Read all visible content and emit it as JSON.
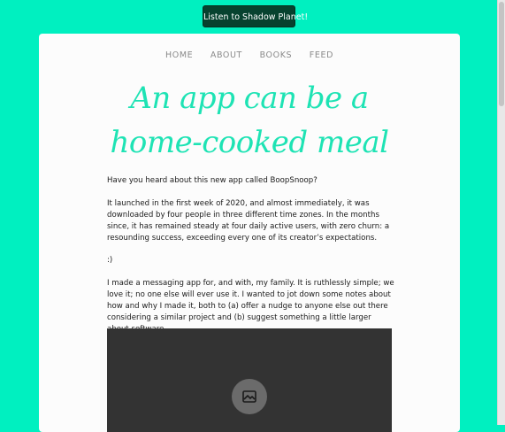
{
  "top_button": {
    "label": "Listen to Shadow Planet!"
  },
  "nav": {
    "items": [
      {
        "label": "HOME"
      },
      {
        "label": "ABOUT"
      },
      {
        "label": "BOOKS"
      },
      {
        "label": "FEED"
      }
    ]
  },
  "post": {
    "title_line1": "An app can be a",
    "title_line2": "home-cooked meal",
    "paragraphs": [
      "Have you heard about this new app called BoopSnoop?",
      "It launched in the first week of 2020, and almost immediately, it was downloaded by four people in three different time zones. In the months since, it has remained steady at four daily active users, with zero churn: a resounding success, exceeding every one of its creator’s expectations.",
      ":)",
      "I made a messaging app for, and with, my family. It is ruthlessly simple; we love it; no one else will ever use it. I wanted to jot down some notes about how and why I made it, both to (a) offer a nudge to anyone else out there considering a similar project and (b) suggest something a little larger about software."
    ]
  },
  "video": {
    "icon": "image-placeholder-icon"
  },
  "colors": {
    "background": "#00f0c0",
    "title": "#1ee3b4",
    "button": "#07422f",
    "nav": "#8a8a8a",
    "video": "#333333"
  }
}
